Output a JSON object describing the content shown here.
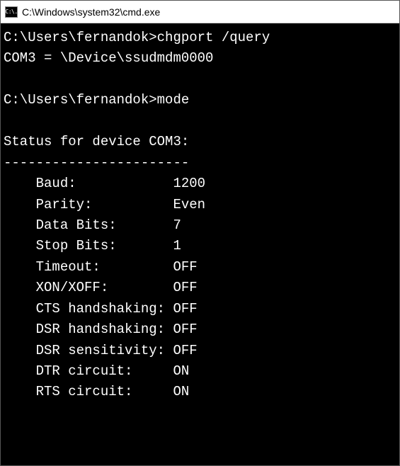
{
  "window": {
    "title": "C:\\Windows\\system32\\cmd.exe",
    "icon_text": "C:\\."
  },
  "terminal": {
    "prompt1": "C:\\Users\\fernandok>",
    "cmd1": "chgport /query",
    "output1": "COM3 = \\Device\\ssudmdm0000",
    "blank": "",
    "prompt2": "C:\\Users\\fernandok>",
    "cmd2": "mode",
    "status_header": "Status for device COM3:",
    "divider": "-----------------------",
    "rows": {
      "baud": "    Baud:            1200",
      "parity": "    Parity:          Even",
      "data_bits": "    Data Bits:       7",
      "stop_bits": "    Stop Bits:       1",
      "timeout": "    Timeout:         OFF",
      "xonxoff": "    XON/XOFF:        OFF",
      "cts": "    CTS handshaking: OFF",
      "dsr": "    DSR handshaking: OFF",
      "dsr_sens": "    DSR sensitivity: OFF",
      "dtr": "    DTR circuit:     ON",
      "rts": "    RTS circuit:     ON"
    }
  }
}
